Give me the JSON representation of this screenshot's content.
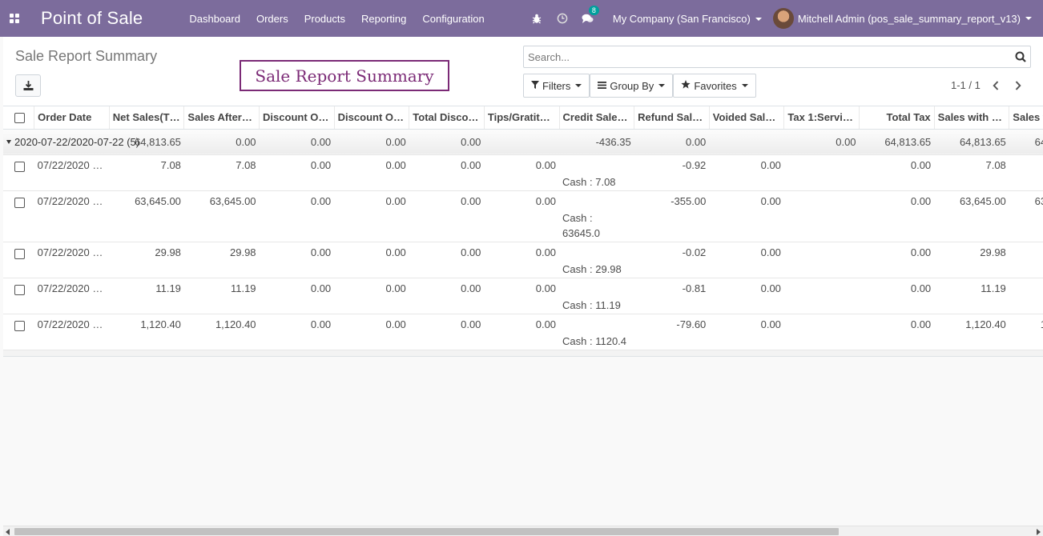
{
  "navbar": {
    "brand": "Point of Sale",
    "menu": [
      "Dashboard",
      "Orders",
      "Products",
      "Reporting",
      "Configuration"
    ],
    "messages_badge": "8",
    "company": "My Company (San Francisco)",
    "user": "Mitchell Admin (pos_sale_summary_report_v13)"
  },
  "control_panel": {
    "title": "Sale Report Summary",
    "banner": "Sale Report Summary",
    "search_placeholder": "Search...",
    "filters_label": "Filters",
    "groupby_label": "Group By",
    "favorites_label": "Favorites",
    "pager": "1-1 / 1"
  },
  "table": {
    "columns": [
      "Order Date",
      "Net Sales(T…",
      "Sales After…",
      "Discount O…",
      "Discount O…",
      "Total Disco…",
      "Tips/Gratit…",
      "Credit Sale…",
      "Refund Sal…",
      "Voided Sal…",
      "Tax 1:Servi…",
      "Total Tax",
      "Sales with …",
      "Sales with …"
    ],
    "group": {
      "label": "2020-07-22/2020-07-22 (5)",
      "values": [
        "64,813.65",
        "64,813.65",
        "0.00",
        "0.00",
        "0.00",
        "0.00",
        "",
        "-436.35",
        "0.00",
        "",
        "0.00",
        "64,813.65",
        "64,813.65"
      ]
    },
    "rows": [
      {
        "date": "07/22/2020 …",
        "values": [
          "7.08",
          "7.08",
          "0.00",
          "0.00",
          "0.00",
          "0.00",
          "",
          "-0.92",
          "0.00",
          "",
          "0.00",
          "7.08",
          "7.08"
        ],
        "credit": [
          "Cash : 7.08"
        ]
      },
      {
        "date": "07/22/2020 …",
        "values": [
          "63,645.00",
          "63,645.00",
          "0.00",
          "0.00",
          "0.00",
          "0.00",
          "",
          "-355.00",
          "0.00",
          "",
          "0.00",
          "63,645.00",
          "63,645.00"
        ],
        "credit": [
          "Cash :",
          "63645.0"
        ]
      },
      {
        "date": "07/22/2020 …",
        "values": [
          "29.98",
          "29.98",
          "0.00",
          "0.00",
          "0.00",
          "0.00",
          "",
          "-0.02",
          "0.00",
          "",
          "0.00",
          "29.98",
          "29.98"
        ],
        "credit": [
          "Cash : 29.98"
        ]
      },
      {
        "date": "07/22/2020 …",
        "values": [
          "11.19",
          "11.19",
          "0.00",
          "0.00",
          "0.00",
          "0.00",
          "",
          "-0.81",
          "0.00",
          "",
          "0.00",
          "11.19",
          "11.19"
        ],
        "credit": [
          "Cash : 11.19"
        ]
      },
      {
        "date": "07/22/2020 …",
        "values": [
          "1,120.40",
          "1,120.40",
          "0.00",
          "0.00",
          "0.00",
          "0.00",
          "",
          "-79.60",
          "0.00",
          "",
          "0.00",
          "1,120.40",
          "1,120.40"
        ],
        "credit": [
          "Cash : 1120.4"
        ]
      }
    ]
  }
}
